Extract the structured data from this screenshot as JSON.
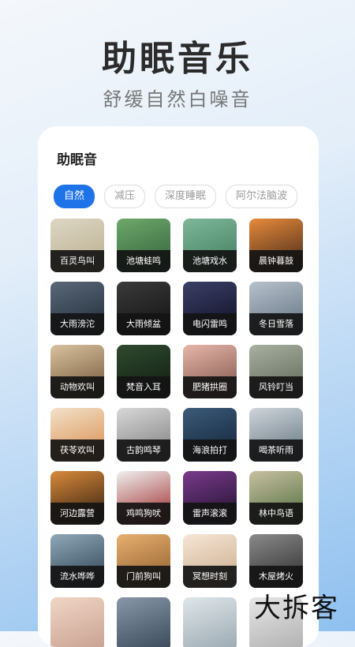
{
  "header": {
    "title": "助眠音乐",
    "subtitle": "舒缓自然白噪音"
  },
  "panel": {
    "title": "助眠音",
    "tabs": [
      {
        "label": "自然",
        "active": true
      },
      {
        "label": "减压",
        "active": false
      },
      {
        "label": "深度睡眠",
        "active": false
      },
      {
        "label": "阿尔法脑波",
        "active": false
      }
    ],
    "items": [
      {
        "label": "百灵鸟叫",
        "colors": [
          "#dcd6c4",
          "#b9ad8c"
        ]
      },
      {
        "label": "池塘蛙鸣",
        "colors": [
          "#6fa86a",
          "#2f5e3a"
        ]
      },
      {
        "label": "池塘戏水",
        "colors": [
          "#7fb89a",
          "#3d7a5d"
        ]
      },
      {
        "label": "晨钟暮鼓",
        "colors": [
          "#e88a3a",
          "#3a2418"
        ]
      },
      {
        "label": "大雨滂沱",
        "colors": [
          "#5a6878",
          "#1f2a36"
        ]
      },
      {
        "label": "大雨倾盆",
        "colors": [
          "#3a3a3a",
          "#111111"
        ]
      },
      {
        "label": "电闪雷鸣",
        "colors": [
          "#3b3f66",
          "#0d0f22"
        ]
      },
      {
        "label": "冬日雪落",
        "colors": [
          "#b6c2ce",
          "#5f6d7a"
        ]
      },
      {
        "label": "动物欢叫",
        "colors": [
          "#d9c2a0",
          "#6e5233"
        ]
      },
      {
        "label": "梵音入耳",
        "colors": [
          "#2f4a2f",
          "#0f1a10"
        ]
      },
      {
        "label": "肥猪拱圈",
        "colors": [
          "#e6b6a8",
          "#7a5048"
        ]
      },
      {
        "label": "风铃叮当",
        "colors": [
          "#a8b1a0",
          "#5a6456"
        ]
      },
      {
        "label": "茯苓欢叫",
        "colors": [
          "#f2e1c8",
          "#d88a4a"
        ]
      },
      {
        "label": "古韵鸣琴",
        "colors": [
          "#d8d8d8",
          "#7a7a7a"
        ]
      },
      {
        "label": "海浪拍打",
        "colors": [
          "#3c5a78",
          "#0f2236"
        ]
      },
      {
        "label": "喝茶听雨",
        "colors": [
          "#cfd6dc",
          "#5f6f7a"
        ]
      },
      {
        "label": "河边露营",
        "colors": [
          "#d98a3a",
          "#2a1a10"
        ]
      },
      {
        "label": "鸡鸣狗吠",
        "colors": [
          "#f0f0f0",
          "#9a2020"
        ]
      },
      {
        "label": "雷声滚滚",
        "colors": [
          "#7a3a8a",
          "#1a0f2a"
        ]
      },
      {
        "label": "林中鸟语",
        "colors": [
          "#c8c0a0",
          "#4a6a3a"
        ]
      },
      {
        "label": "流水哗哗",
        "colors": [
          "#8fa8b8",
          "#2a3e4e"
        ]
      },
      {
        "label": "门前狗叫",
        "colors": [
          "#e8b070",
          "#8a5a2a"
        ]
      },
      {
        "label": "冥想时刻",
        "colors": [
          "#f6e6d6",
          "#c8a888"
        ]
      },
      {
        "label": "木屋烤火",
        "colors": [
          "#8a8a8a",
          "#2a2a2a"
        ]
      },
      {
        "label": "",
        "colors": [
          "#f0d6c6",
          "#c8a090"
        ]
      },
      {
        "label": "",
        "colors": [
          "#8898a8",
          "#3a4858"
        ]
      },
      {
        "label": "",
        "colors": [
          "#dfe6ea",
          "#9aa8b0"
        ]
      },
      {
        "label": "",
        "colors": [
          "#e6e6e6",
          "#b0b0b0"
        ]
      }
    ]
  },
  "brand": {
    "text": "大拆客"
  }
}
